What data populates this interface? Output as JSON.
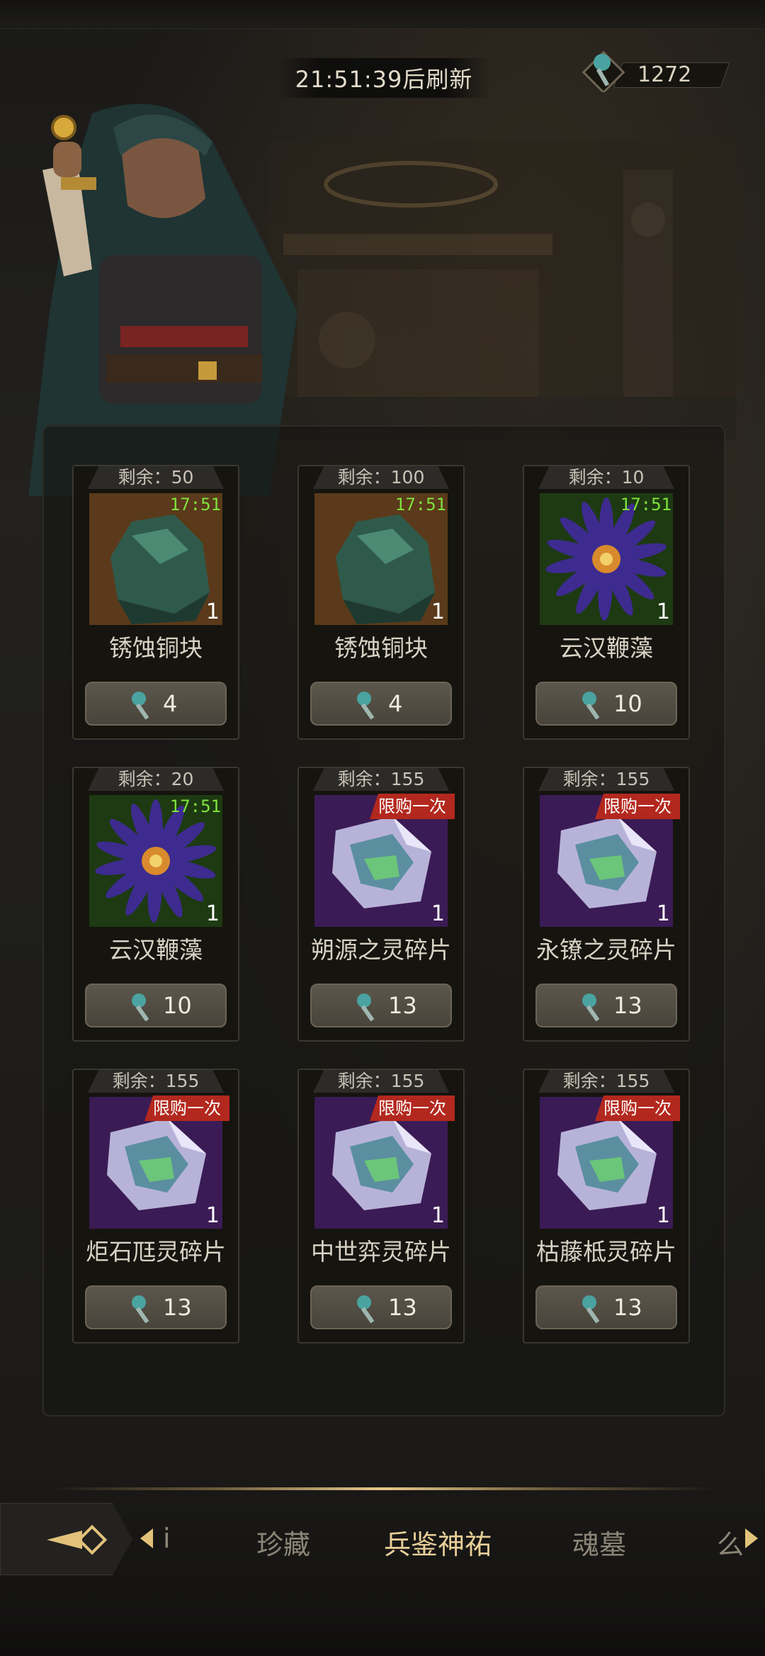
{
  "header": {
    "refresh_timer": "21:51:39后刷新",
    "currency_amount": "1272",
    "currency_icon": "spirit-key-icon"
  },
  "cards": [
    {
      "remaining": "剩余：50",
      "timer": "17:51",
      "qty": "1",
      "name": "锈蚀铜块",
      "price": "4",
      "kind": "ore"
    },
    {
      "remaining": "剩余：100",
      "timer": "17:51",
      "qty": "1",
      "name": "锈蚀铜块",
      "price": "4",
      "kind": "ore"
    },
    {
      "remaining": "剩余：10",
      "timer": "17:51",
      "qty": "1",
      "name": "云汉鞭藻",
      "price": "10",
      "kind": "flower"
    },
    {
      "remaining": "剩余：20",
      "timer": "17:51",
      "qty": "1",
      "name": "云汉鞭藻",
      "price": "10",
      "kind": "flower"
    },
    {
      "remaining": "剩余：155",
      "tag": "限购一次",
      "qty": "1",
      "name": "朔源之灵碎片",
      "price": "13",
      "kind": "crystal"
    },
    {
      "remaining": "剩余：155",
      "tag": "限购一次",
      "qty": "1",
      "name": "永镣之灵碎片",
      "price": "13",
      "kind": "crystal"
    },
    {
      "remaining": "剩余：155",
      "tag": "限购一次",
      "qty": "1",
      "name": "炬石尫灵碎片",
      "price": "13",
      "kind": "crystal"
    },
    {
      "remaining": "剩余：155",
      "tag": "限购一次",
      "qty": "1",
      "name": "中世弈灵碎片",
      "price": "13",
      "kind": "crystal"
    },
    {
      "remaining": "剩余：155",
      "tag": "限购一次",
      "qty": "1",
      "name": "枯藤柢灵碎片",
      "price": "13",
      "kind": "crystal"
    }
  ],
  "nav": {
    "tabs": [
      "i",
      "珍藏",
      "兵鉴神祐",
      "魂墓",
      "么"
    ],
    "active_index": 2
  },
  "colors": {
    "timer_green": "#7fe23e",
    "tag_red": "#b3281e",
    "active_tab": "#e8cf98"
  }
}
